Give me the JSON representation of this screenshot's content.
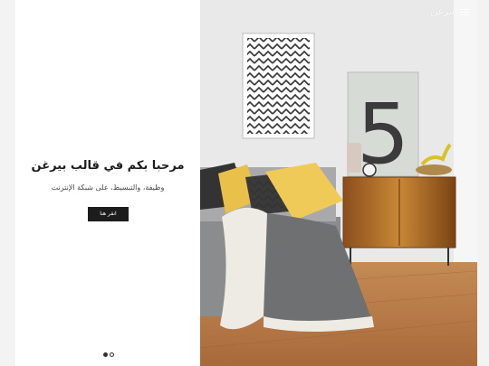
{
  "header": {
    "logo_text": "بيرغن",
    "menu_icon": "hamburger-menu-icon"
  },
  "hero": {
    "title": "مرحبا بكم في قالب بيرغن",
    "subtitle": "وظيفة، والتبسيط، على شبكة الإنترنت",
    "cta_label": "انقر هنا"
  },
  "slider": {
    "slide_count": 2,
    "active_index": 0
  },
  "photo_art": {
    "frame_number": "5"
  },
  "colors": {
    "accent": "#1c1c1c",
    "background": "#ffffff"
  }
}
